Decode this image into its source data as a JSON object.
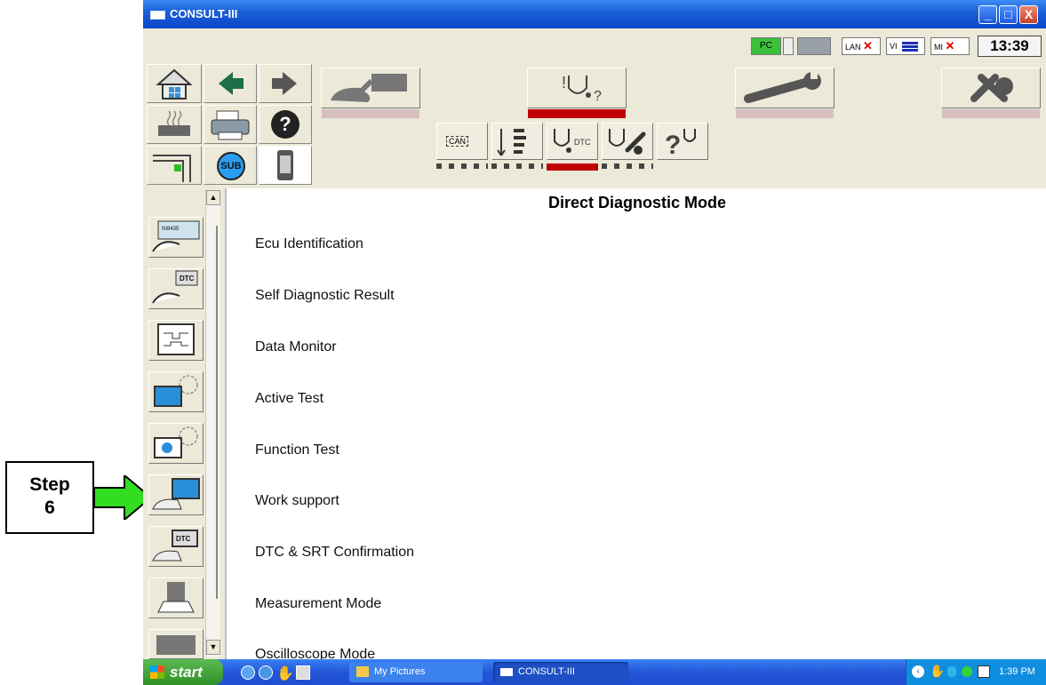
{
  "window": {
    "title": "CONSULT-III",
    "minimize": "_",
    "maximize": "□",
    "close": "X"
  },
  "status": {
    "pc": "PC",
    "lan": "LAN",
    "vi": "VI",
    "mi": "MI",
    "clock": "13:39"
  },
  "toolbar": {
    "sub_label": "SUB",
    "can_label": "CAN",
    "dtc_label": "DTC"
  },
  "side": {
    "btn1_tag": "NI8435",
    "btn2_tag": "DTC",
    "btn7_tag": "DTC"
  },
  "main": {
    "heading": "Direct Diagnostic Mode",
    "items": [
      "Ecu Identification",
      "Self Diagnostic Result",
      "Data Monitor",
      "Active Test",
      "Function Test",
      "Work support",
      "DTC & SRT Confirmation",
      "Measurement Mode",
      "Oscilloscope Mode"
    ]
  },
  "taskbar": {
    "start": "start",
    "tasks": [
      "My Pictures",
      "CONSULT-III"
    ],
    "time": "1:39 PM"
  },
  "annotation": {
    "step_line1": "Step",
    "step_line2": "6"
  },
  "colors": {
    "accent": "#c00000",
    "window_bg": "#ece9d8",
    "taskbar": "#245edb",
    "arrow": "#33dd22"
  }
}
